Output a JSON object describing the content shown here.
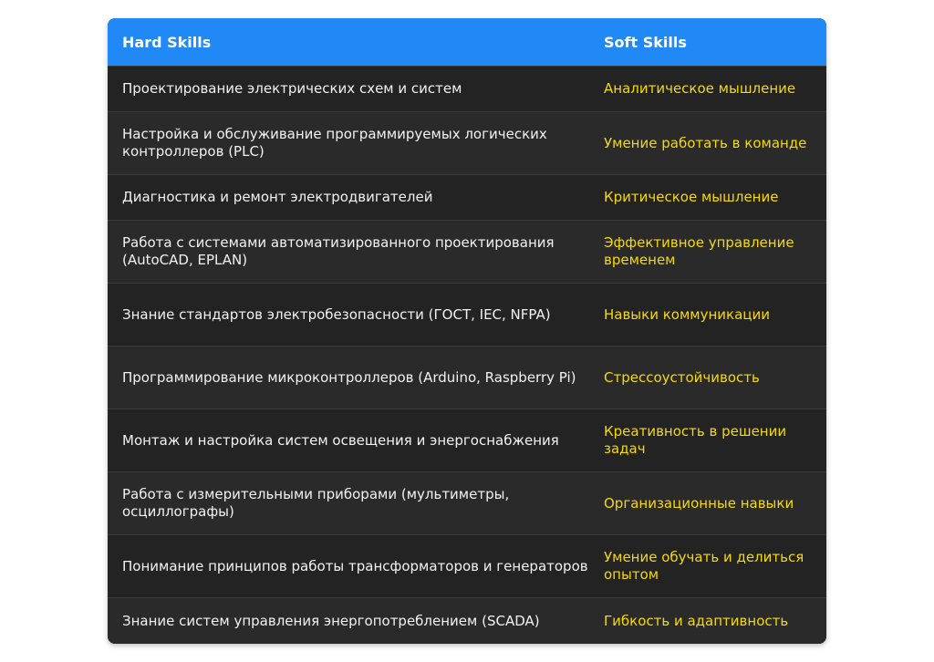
{
  "table": {
    "headers": {
      "hard": "Hard Skills",
      "soft": "Soft Skills"
    },
    "rows": [
      {
        "hard": "Проектирование электрических схем и систем",
        "soft": "Аналитическое мышление"
      },
      {
        "hard": "Настройка и обслуживание программируемых логических контроллеров (PLC)",
        "soft": "Умение работать в команде"
      },
      {
        "hard": "Диагностика и ремонт электродвигателей",
        "soft": "Критическое мышление"
      },
      {
        "hard": "Работа с системами автоматизированного проектирования (AutoCAD, EPLAN)",
        "soft": "Эффективное управление временем"
      },
      {
        "hard": "Знание стандартов электробезопасности (ГОСТ, IEC, NFPA)",
        "soft": "Навыки коммуникации"
      },
      {
        "hard": "Программирование микроконтроллеров (Arduino, Raspberry Pi)",
        "soft": "Стрессоустойчивость"
      },
      {
        "hard": "Монтаж и настройка систем освещения и энергоснабжения",
        "soft": "Креативность в решении задач"
      },
      {
        "hard": "Работа с измерительными приборами (мультиметры, осциллографы)",
        "soft": "Организационные навыки"
      },
      {
        "hard": "Понимание принципов работы трансформаторов и генераторов",
        "soft": "Умение обучать и делиться опытом"
      },
      {
        "hard": "Знание систем управления энергопотреблением (SCADA)",
        "soft": "Гибкость и адаптивность"
      }
    ]
  },
  "colors": {
    "header_bg": "#2189f5",
    "body_bg": "#232323",
    "hard_text": "#f2f2f2",
    "soft_text": "#f5d90a"
  }
}
